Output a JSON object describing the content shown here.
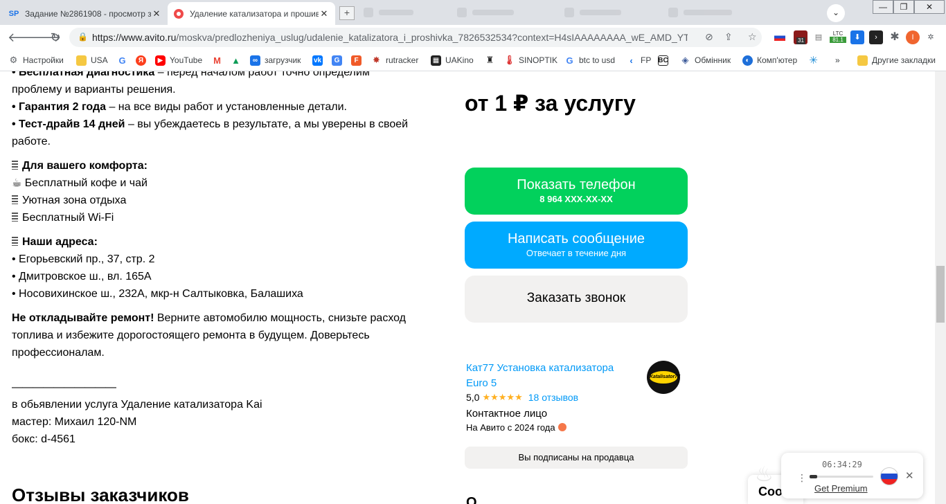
{
  "browser": {
    "tabs": [
      {
        "favicon": "SP",
        "title": "Задание №2861908 - просмотр з",
        "active": false
      },
      {
        "favicon": "avito-dot",
        "title": "Удаление катализатора и прошив",
        "active": true
      }
    ],
    "new_tab_symbol": "+",
    "win_minimize": "—",
    "win_maximize": "❐",
    "win_close": "✕",
    "url_host": "https://www.avito.ru",
    "url_rest": "/moskva/predlozheniya_uslug/udalenie_katalizatora_i_proshivka_7826532534?context=H4sIAAAAAAAA_wE_AMD_YTo...",
    "back": "🡐",
    "forward": "🡒",
    "reload": "↻",
    "extensions": {
      "badge_31": "31",
      "ltc_label": "LTC",
      "ltc_value": "81.1",
      "profile_letter": "I"
    },
    "bookmarks": [
      {
        "label": "Настройки",
        "icon": "gear-icon"
      },
      {
        "label": "USA",
        "icon": "folder-icon"
      },
      {
        "label": "",
        "icon": "google-icon"
      },
      {
        "label": "",
        "icon": "yandex-icon"
      },
      {
        "label": "YouTube",
        "icon": "youtube-icon"
      },
      {
        "label": "",
        "icon": "gmail-icon"
      },
      {
        "label": "",
        "icon": "drive-icon"
      },
      {
        "label": "загрузчик",
        "icon": "loader-icon"
      },
      {
        "label": "",
        "icon": "vk-icon"
      },
      {
        "label": "",
        "icon": "translate-icon"
      },
      {
        "label": "",
        "icon": "f-icon"
      },
      {
        "label": "rutracker",
        "icon": "rutracker-icon"
      },
      {
        "label": "UAKino",
        "icon": "uakino-icon"
      },
      {
        "label": "",
        "icon": "figure-icon"
      },
      {
        "label": "SINOPTIK",
        "icon": "thermometer-icon"
      },
      {
        "label": "btc to usd",
        "icon": "google-icon"
      },
      {
        "label": "FP",
        "icon": "fp-icon"
      },
      {
        "label": "",
        "icon": "bc-icon"
      },
      {
        "label": "Обмінник",
        "icon": "exchange-icon"
      },
      {
        "label": "Комп'ютер",
        "icon": "computer-icon"
      },
      {
        "label": "",
        "icon": "star-burst-icon"
      }
    ],
    "bookmarks_more": "»",
    "other_bookmarks": "Другие закладки"
  },
  "description": {
    "line1_bold": "• Бесплатная диагностика",
    "line1_rest": " – перед началом работ точно определим",
    "line2": "проблему и варианты решения.",
    "line3_bold": "• Гарантия 2 года",
    "line3_rest": " – на все виды работ и установленные детали.",
    "line4_bold": "• Тест-драйв 14 дней",
    "line4_rest": " – вы убеждаетесь в результате, а мы уверены в своей",
    "line5": "работе.",
    "comfort_title": "Для вашего комфорта:",
    "comfort_items": [
      "☕ Бесплатный кофе и чай",
      "Уютная зона отдыха",
      "Бесплатный Wi-Fi"
    ],
    "address_title": "Наши адреса:",
    "addresses": [
      "• Егорьевский пр., 37, стр. 2",
      "• Дмитровское ш., вл. 165А",
      "• Носовихинское ш., 232А, мкр-н Салтыковка, Балашиха"
    ],
    "cta_bold": "Не откладывайте ремонт!",
    "cta_rest1": " Верните автомобилю мощность, снизьте расход",
    "cta_line2": "топлива и избежите дорогостоящего ремонта в будущем. Доверьтесь",
    "cta_line3": "профессионалам.",
    "separator": "——————————",
    "meta1": "в обьявлении услуга Удаление катализатора Kai",
    "meta2": "мастер: Михаил 120-NM",
    "meta3": "бокс: d-4561"
  },
  "reviews_title": "Отзывы заказчиков",
  "price": "от 1 ₽ за услугу",
  "buttons": {
    "phone_label": "Показать телефон",
    "phone_sub": "8 964 XXX-XX-XX",
    "message_label": "Написать сообщение",
    "message_sub": "Отвечает в течение дня",
    "call_label": "Заказать звонок"
  },
  "seller": {
    "name": "Кат77 Установка катализатора Euro 5",
    "logo_text": "Katalisator77",
    "rating": "5,0",
    "stars": "★★★★★",
    "reviews": "18 отзывов",
    "contact": "Контактное лицо",
    "since": "На Авито с 2024 года",
    "subscribed": "Вы подписаны на продавца"
  },
  "bottom_peek": "О",
  "chat": {
    "text": "Coo"
  },
  "player": {
    "time": "06:34:29",
    "progress": 0.12,
    "premium": "Get Premium",
    "menu": "⋮",
    "close": "✕"
  },
  "colors": {
    "phone": "#02d15c",
    "message": "#00aaff",
    "link": "#0099f7",
    "star": "#ffb021"
  }
}
